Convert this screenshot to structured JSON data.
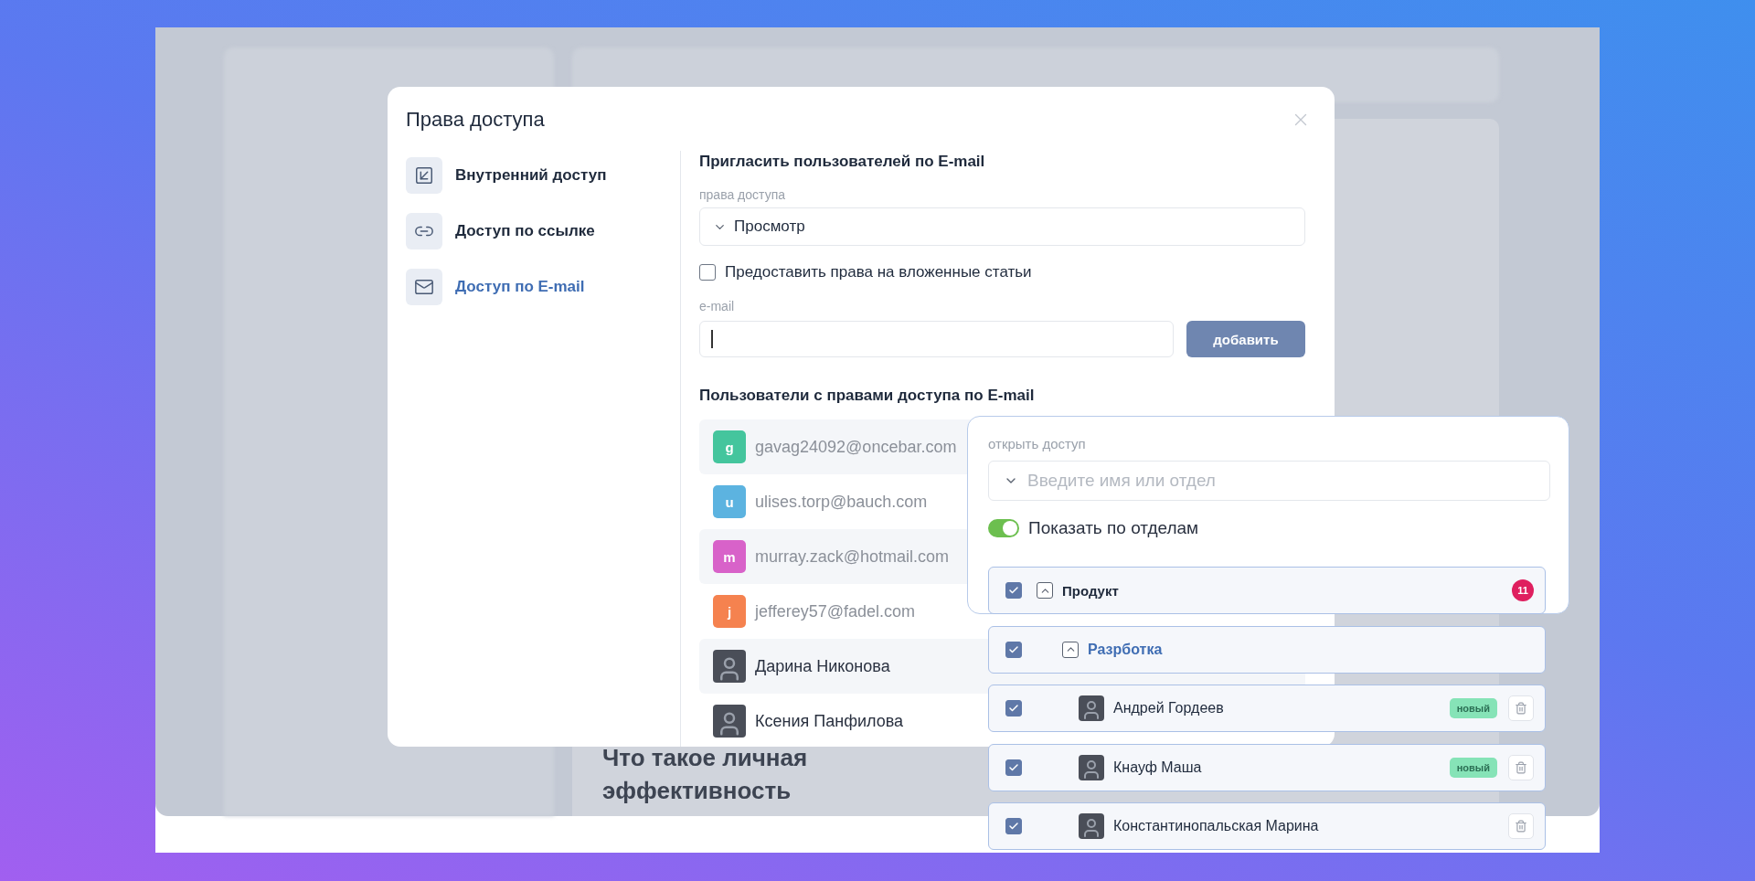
{
  "background": {
    "heading": "Что такое личная эффективность"
  },
  "dialog": {
    "title": "Права доступа",
    "nav": [
      {
        "label": "Внутренний доступ",
        "selected": false
      },
      {
        "label": "Доступ по ссылке",
        "selected": false
      },
      {
        "label": "Доступ по E-mail",
        "selected": true
      }
    ],
    "invite": {
      "heading": "Пригласить пользователей по E-mail",
      "rights_label": "права доступа",
      "rights_value": "Просмотр",
      "nested": {
        "label": "Предоставить права на вложенные статьи",
        "checked": false
      },
      "email_label": "e-mail",
      "add_button": "добавить"
    },
    "users": {
      "heading": "Пользователи с правами доступа по E-mail",
      "items": [
        {
          "kind": "email",
          "initial": "g",
          "name": "gavag24092@oncebar.com",
          "color": "#44c59d"
        },
        {
          "kind": "email",
          "initial": "u",
          "name": "ulises.torp@bauch.com",
          "color": "#5cb3e0"
        },
        {
          "kind": "email",
          "initial": "m",
          "name": "murray.zack@hotmail.com",
          "color": "#d862c9"
        },
        {
          "kind": "email",
          "initial": "j",
          "name": "jefferey57@fadel.com",
          "color": "#f5824f"
        },
        {
          "kind": "person",
          "name": "Дарина Никонова"
        },
        {
          "kind": "person",
          "name": "Ксения Панфилова"
        }
      ]
    }
  },
  "access_panel": {
    "label": "открыть доступ",
    "placeholder": "Введите имя или отдел",
    "toggle": {
      "label": "Показать по отделам",
      "on": true
    },
    "tree": [
      {
        "name": "Продукт",
        "checked": true,
        "expanded": true,
        "selected": false,
        "count": "11",
        "children": [
          {
            "name": "Разрботка",
            "checked": true,
            "expanded": true,
            "selected": true,
            "children": [
              {
                "name": "Андрей Гордеев",
                "checked": true,
                "badge": "новый"
              },
              {
                "name": "Кнауф Маша",
                "checked": true,
                "badge": "новый"
              },
              {
                "name": "Константинопальская Марина",
                "checked": true
              }
            ]
          }
        ]
      }
    ]
  }
}
